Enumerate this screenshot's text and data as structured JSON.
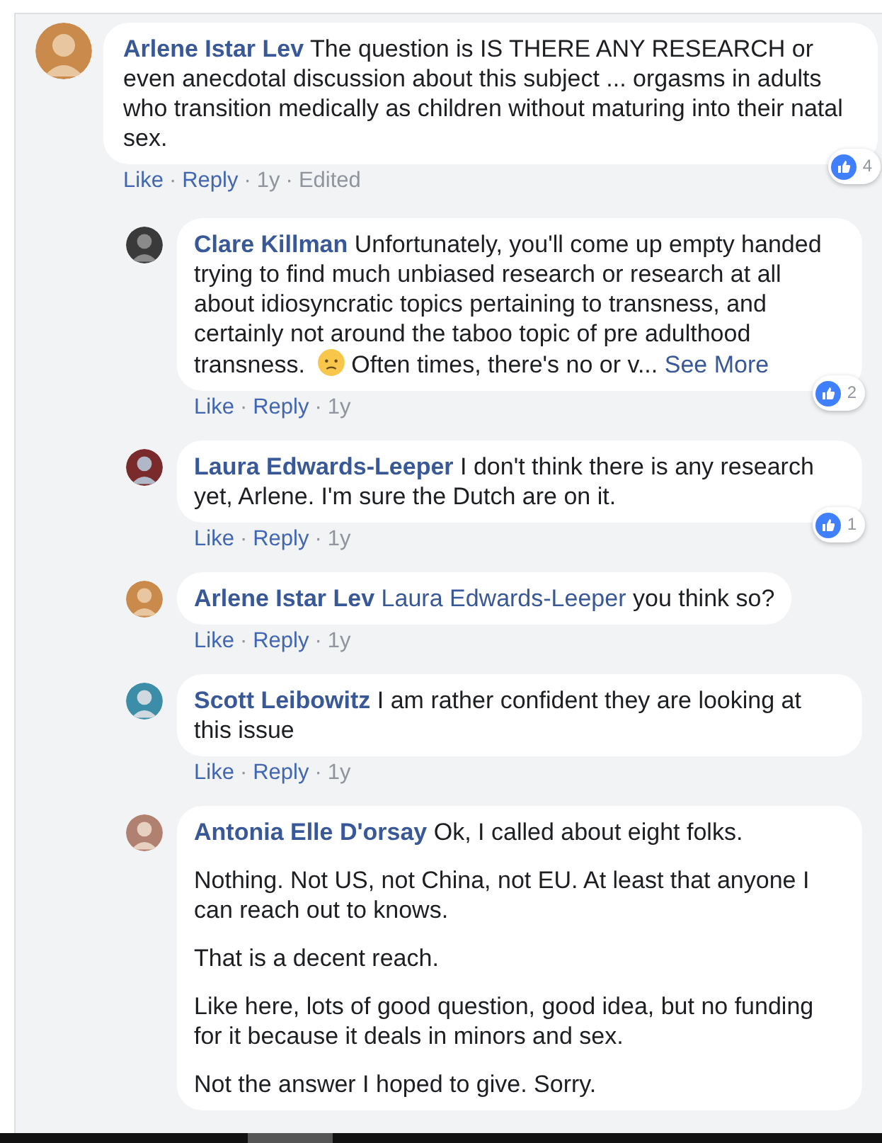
{
  "comments": [
    {
      "author": "Arlene Istar Lev",
      "body": [
        {
          "kind": "text",
          "text": "The question is IS THERE ANY RESEARCH or even anecdotal discussion about this subject ... orgasms in adults who transition medically as children without maturing into their natal sex."
        }
      ],
      "reactions": "4",
      "footer": [
        {
          "kind": "link",
          "text": "Like"
        },
        {
          "kind": "sep",
          "text": "·"
        },
        {
          "kind": "link",
          "text": "Reply"
        },
        {
          "kind": "sep",
          "text": "·"
        },
        {
          "kind": "meta",
          "text": "1y"
        },
        {
          "kind": "sep",
          "text": "·"
        },
        {
          "kind": "meta",
          "text": "Edited"
        }
      ],
      "replies": [
        {
          "author": "Clare Killman",
          "body": [
            {
              "kind": "text",
              "text": "Unfortunately, you'll come up empty handed trying to find much unbiased research or research at all about idiosyncratic topics pertaining to transness, and certainly not around the taboo topic of pre adulthood transness."
            },
            {
              "kind": "emoji"
            },
            {
              "kind": "text",
              "text": "Often times, there's no or v..."
            },
            {
              "kind": "link",
              "text": "See More"
            }
          ],
          "reactions": "2",
          "footer": [
            {
              "kind": "link",
              "text": "Like"
            },
            {
              "kind": "sep",
              "text": "·"
            },
            {
              "kind": "link",
              "text": "Reply"
            },
            {
              "kind": "sep",
              "text": "·"
            },
            {
              "kind": "meta",
              "text": "1y"
            }
          ]
        },
        {
          "author": "Laura Edwards-Leeper",
          "body": [
            {
              "kind": "text",
              "text": "I don't think there is any research yet, Arlene. I'm sure the Dutch are on it."
            }
          ],
          "reactions": "1",
          "footer": [
            {
              "kind": "link",
              "text": "Like"
            },
            {
              "kind": "sep",
              "text": "·"
            },
            {
              "kind": "link",
              "text": "Reply"
            },
            {
              "kind": "sep",
              "text": "·"
            },
            {
              "kind": "meta",
              "text": "1y"
            }
          ]
        },
        {
          "author": "Arlene Istar Lev",
          "body": [
            {
              "kind": "mention",
              "text": "Laura Edwards-Leeper"
            },
            {
              "kind": "text",
              "text": "you think so?"
            }
          ],
          "footer": [
            {
              "kind": "link",
              "text": "Like"
            },
            {
              "kind": "sep",
              "text": "·"
            },
            {
              "kind": "link",
              "text": "Reply"
            },
            {
              "kind": "sep",
              "text": "·"
            },
            {
              "kind": "meta",
              "text": "1y"
            }
          ]
        },
        {
          "author": "Scott Leibowitz",
          "body": [
            {
              "kind": "text",
              "text": "I am rather confident they are looking at this issue"
            }
          ],
          "footer": [
            {
              "kind": "link",
              "text": "Like"
            },
            {
              "kind": "sep",
              "text": "·"
            },
            {
              "kind": "link",
              "text": "Reply"
            },
            {
              "kind": "sep",
              "text": "·"
            },
            {
              "kind": "meta",
              "text": "1y"
            }
          ]
        },
        {
          "author": "Antonia Elle D'orsay",
          "body": [
            {
              "kind": "text",
              "text": "Ok, I called about eight folks."
            }
          ],
          "paragraphs": [
            "Nothing. Not US, not China, not EU. At least that anyone I can reach out to knows.",
            "That is a decent reach.",
            "Like here, lots of good question, good idea, but no funding for it because it deals in minors and sex.",
            "Not the answer I hoped to give. Sorry."
          ]
        }
      ]
    }
  ]
}
